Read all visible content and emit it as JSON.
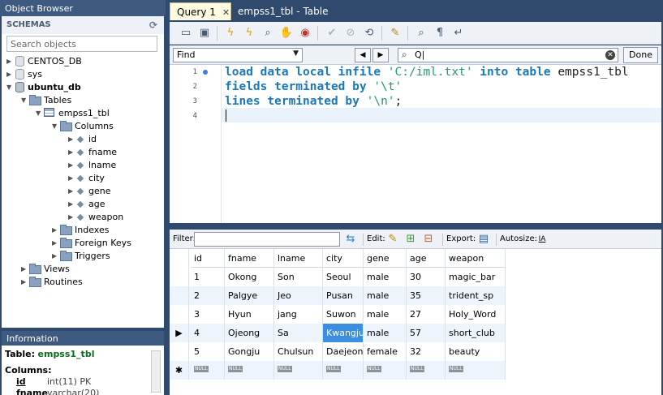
{
  "object_browser": {
    "title": "Object Browser",
    "schemas_label": "SCHEMAS",
    "search_placeholder": "Search objects",
    "tree": {
      "db1": "CENTOS_DB",
      "db2": "sys",
      "db3": "ubuntu_db",
      "tables": "Tables",
      "table": "empss1_tbl",
      "columns": "Columns",
      "cols": [
        "id",
        "fname",
        "lname",
        "city",
        "gene",
        "age",
        "weapon"
      ],
      "indexes": "Indexes",
      "fks": "Foreign Keys",
      "triggers": "Triggers",
      "views": "Views",
      "routines": "Routines"
    }
  },
  "information": {
    "title": "Information",
    "table_label": "Table:",
    "table_name": "empss1_tbl",
    "columns_label": "Columns:",
    "col1_name": "id",
    "col1_type": "int(11) PK",
    "col2_name": "fname",
    "col2_type": "varchar(20)"
  },
  "tabs": {
    "active": "Query 1",
    "close": "✕",
    "inactive": "empss1_tbl - Table"
  },
  "find": {
    "mode": "Find",
    "search_glyph": "Q|",
    "done": "Done"
  },
  "editor": {
    "line_numbers": [
      "1",
      "2",
      "3",
      "4"
    ],
    "l1_kw": "load data local infile ",
    "l1_str": "'C:/iml.txt'",
    "l1_kw2": " into table ",
    "l1_id": "empss1_tbl",
    "l2_kw": "fields terminated by ",
    "l2_str": "'\\t'",
    "l3_kw": "lines terminated by ",
    "l3_str": "'\\n'",
    "l3_end": ";"
  },
  "result_bar": {
    "filter_label": "Filter:",
    "edit_label": "Edit:",
    "export_label": "Export:",
    "autosize_label": "Autosize:",
    "autosize_icon": "IA"
  },
  "grid": {
    "headers": [
      "id",
      "fname",
      "lname",
      "city",
      "gene",
      "age",
      "weapon"
    ],
    "rows": [
      [
        "1",
        "Okong",
        "Son",
        "Seoul",
        "male",
        "30",
        "magic_bar"
      ],
      [
        "2",
        "Palgye",
        "Jeo",
        "Pusan",
        "male",
        "35",
        "trident_sp"
      ],
      [
        "3",
        "Hyun",
        "jang",
        "Suwon",
        "male",
        "27",
        "Holy_Word"
      ],
      [
        "4",
        "Ojeong",
        "Sa",
        "Kwangju",
        "male",
        "57",
        "short_club"
      ],
      [
        "5",
        "Gongju",
        "Chulsun",
        "Daejeon",
        "female",
        "32",
        "beauty"
      ]
    ],
    "null_label": "NULL",
    "new_row_marker": "✱",
    "current_row_marker": "▶"
  }
}
